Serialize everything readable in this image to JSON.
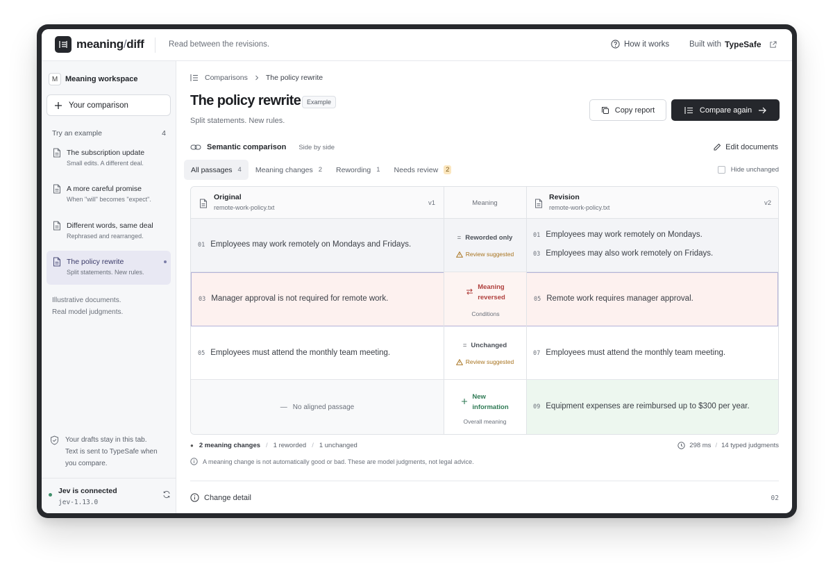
{
  "app": {
    "name_main": "meaning",
    "name_slash": "/",
    "name_end": "diff",
    "tagline": "Read between the revisions."
  },
  "header": {
    "how_it_works": "How it works",
    "built_with": "Built with",
    "brand": "TypeSafe"
  },
  "sidebar": {
    "workspace_initial": "M",
    "workspace": "Meaning workspace",
    "your_comparison": "Your comparison",
    "try_example": "Try an example",
    "try_count": "4",
    "examples": [
      {
        "title": "The subscription update",
        "subtitle": "Small edits. A different deal."
      },
      {
        "title": "A more careful promise",
        "subtitle": "When \"will\" becomes \"expect\"."
      },
      {
        "title": "Different words, same deal",
        "subtitle": "Rephrased and rearranged."
      },
      {
        "title": "The policy rewrite",
        "subtitle": "Split statements. New rules."
      }
    ],
    "illustrative_1": "Illustrative documents.",
    "illustrative_2": "Real model judgments.",
    "drafts_1": "Your drafts stay in this tab.",
    "drafts_2": "Text is sent to TypeSafe when",
    "drafts_3": "you compare.",
    "connection": "Jev is connected",
    "version": "jev-1.13.0"
  },
  "breadcrumb": {
    "root": "Comparisons",
    "current": "The policy rewrite"
  },
  "page": {
    "title": "The policy rewrite",
    "badge": "Example",
    "subtitle": "Split statements. New rules."
  },
  "actions": {
    "copy": "Copy report",
    "compare": "Compare again"
  },
  "section": {
    "title": "Semantic comparison",
    "mode": "Side by side",
    "edit": "Edit documents"
  },
  "tabs": [
    {
      "label": "All passages",
      "count": "4"
    },
    {
      "label": "Meaning changes",
      "count": "2"
    },
    {
      "label": "Rewording",
      "count": "1"
    },
    {
      "label": "Needs review",
      "count": "2"
    }
  ],
  "hide_unchanged": "Hide unchanged",
  "columns": {
    "original": {
      "title": "Original",
      "file": "remote-work-policy.txt",
      "version": "v1"
    },
    "meaning": "Meaning",
    "revision": {
      "title": "Revision",
      "file": "remote-work-policy.txt",
      "version": "v2"
    }
  },
  "rows": [
    {
      "left_num": "01",
      "left": "Employees may work remotely on Mondays and Fridays.",
      "verdict": "Reworded only",
      "note": "Review suggested",
      "right": [
        {
          "num": "01",
          "text": "Employees may work remotely on Mondays."
        },
        {
          "num": "03",
          "text": "Employees may also work remotely on Fridays."
        }
      ]
    },
    {
      "left_num": "03",
      "left": "Manager approval is not required for remote work.",
      "verdict_1": "Meaning",
      "verdict_2": "reversed",
      "note": "Conditions",
      "right_num": "05",
      "right": "Remote work requires manager approval."
    },
    {
      "left_num": "05",
      "left": "Employees must attend the monthly team meeting.",
      "verdict": "Unchanged",
      "note": "Review suggested",
      "right_num": "07",
      "right": "Employees must attend the monthly team meeting."
    },
    {
      "left": "No aligned passage",
      "verdict_1": "New",
      "verdict_2": "information",
      "note": "Overall meaning",
      "right_num": "09",
      "right": "Equipment expenses are reimbursed up to $300 per year."
    }
  ],
  "stats": {
    "meaning_changes": "2 meaning changes",
    "reworded": "1 reworded",
    "unchanged": "1 unchanged",
    "time": "298 ms",
    "judgments": "14 typed judgments"
  },
  "disclaimer": "A meaning change is not automatically good or bad. These are model judgments, not legal advice.",
  "detail": {
    "label": "Change detail",
    "index": "02"
  },
  "colors": {
    "accent_dark": "#25272c",
    "reversed": "#b0413e",
    "new": "#2f7a55",
    "warn": "#a87420",
    "highlight_border": "#b3b2d8"
  }
}
